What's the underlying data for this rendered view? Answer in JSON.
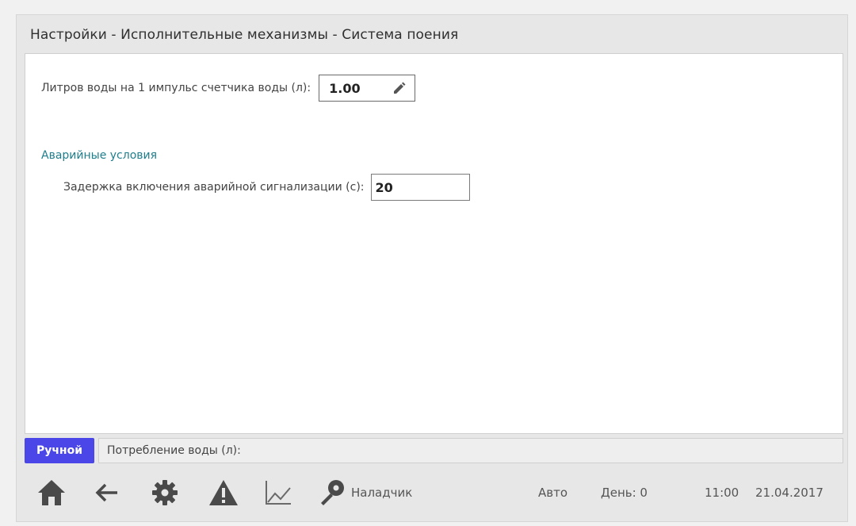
{
  "header": {
    "title": "Настройки - Исполнительные механизмы - Система поения"
  },
  "settings": {
    "liters_label": "Литров воды на 1 импульс счетчика воды (л):",
    "liters_value": "1.00",
    "edit_icon": "pencil-icon",
    "alarm_section_title": "Аварийные условия",
    "alarm_delay_label": "Задержка включения аварийной сигнализации (с):",
    "alarm_delay_value": "20"
  },
  "statusbar": {
    "mode_label": "Ручной",
    "consumption_label": "Потребление воды (л):",
    "mode_color": "#4a46e8"
  },
  "toolbar": {
    "icons": [
      "home-icon",
      "back-arrow-icon",
      "gear-icon",
      "warning-icon",
      "chart-icon",
      "key-icon"
    ],
    "user_label": "Наладчик",
    "auto_label": "Авто",
    "day_label": "День: 0",
    "time": "11:00",
    "date": "21.04.2017"
  }
}
